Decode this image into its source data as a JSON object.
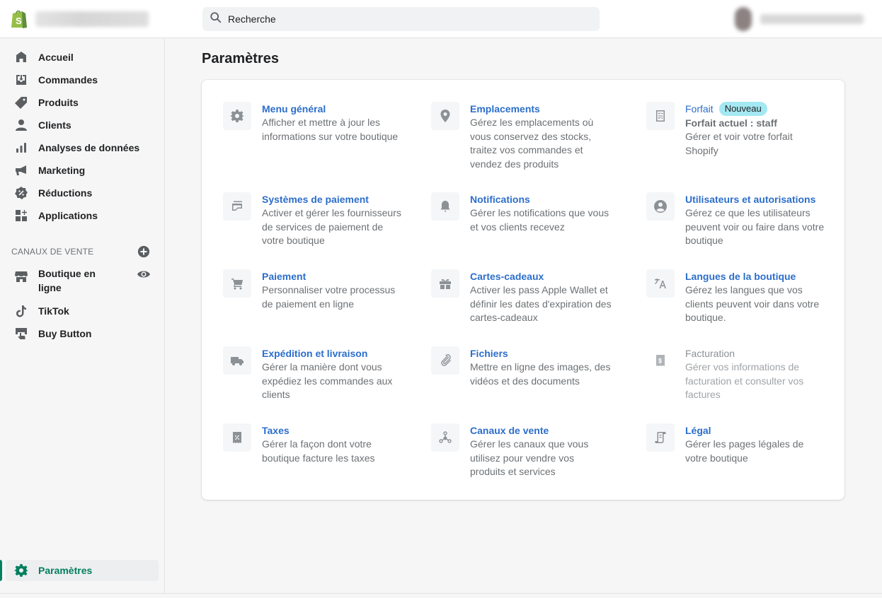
{
  "topbar": {
    "search_placeholder": "Recherche"
  },
  "sidebar": {
    "items": [
      {
        "label": "Accueil",
        "icon": "home-icon"
      },
      {
        "label": "Commandes",
        "icon": "orders-icon"
      },
      {
        "label": "Produits",
        "icon": "tag-icon"
      },
      {
        "label": "Clients",
        "icon": "person-icon"
      },
      {
        "label": "Analyses de données",
        "icon": "analytics-icon"
      },
      {
        "label": "Marketing",
        "icon": "megaphone-icon"
      },
      {
        "label": "Réductions",
        "icon": "discount-icon"
      },
      {
        "label": "Applications",
        "icon": "apps-icon"
      }
    ],
    "channels_title": "CANAUX DE VENTE",
    "channels": [
      {
        "label": "Boutique en ligne",
        "icon": "store-icon"
      },
      {
        "label": "TikTok",
        "icon": "tiktok-icon"
      },
      {
        "label": "Buy Button",
        "icon": "buy-button-icon"
      }
    ],
    "settings_label": "Paramètres"
  },
  "main": {
    "title": "Paramètres",
    "settings": [
      {
        "title": "Menu général",
        "description": "Afficher et mettre à jour les informations sur votre boutique",
        "icon": "gear-icon"
      },
      {
        "title": "Emplacements",
        "description": "Gérez les emplacements où vous conservez des stocks, traitez vos commandes et vendez des produits",
        "icon": "location-pin-icon"
      },
      {
        "title": "Forfait",
        "badge": "Nouveau",
        "subtitle": "Forfait actuel : staff",
        "description": "Gérer et voir votre forfait Shopify",
        "icon": "plan-icon"
      },
      {
        "title": "Systèmes de paiement",
        "description": "Activer et gérer les fournisseurs de services de paiement de votre boutique",
        "icon": "payment-card-icon"
      },
      {
        "title": "Notifications",
        "description": "Gérer les notifications que vous et vos clients recevez",
        "icon": "bell-icon"
      },
      {
        "title": "Utilisateurs et autorisations",
        "description": "Gérez ce que les utilisateurs peuvent voir ou faire dans votre boutique",
        "icon": "user-circle-icon"
      },
      {
        "title": "Paiement",
        "description": "Personnaliser votre processus de paiement en ligne",
        "icon": "cart-icon"
      },
      {
        "title": "Cartes-cadeaux",
        "description": "Activer les pass Apple Wallet et définir les dates d'expiration des cartes-cadeaux",
        "icon": "gift-icon"
      },
      {
        "title": "Langues de la boutique",
        "description": "Gérez les langues que vos clients peuvent voir dans votre boutique.",
        "icon": "translate-icon"
      },
      {
        "title": "Expédition et livraison",
        "description": "Gérer la manière dont vous expédiez les commandes aux clients",
        "icon": "truck-icon"
      },
      {
        "title": "Fichiers",
        "description": "Mettre en ligne des images, des vidéos et des documents",
        "icon": "paperclip-icon"
      },
      {
        "title": "Facturation",
        "description": "Gérer vos informations de facturation et consulter vos factures",
        "icon": "billing-icon",
        "disabled": true
      },
      {
        "title": "Taxes",
        "description": "Gérer la façon dont votre boutique facture les taxes",
        "icon": "tax-receipt-icon"
      },
      {
        "title": "Canaux de vente",
        "description": "Gérer les canaux que vous utilisez pour vendre vos produits et services",
        "icon": "channels-icon"
      },
      {
        "title": "Légal",
        "description": "Gérer les pages légales de votre boutique",
        "icon": "legal-scroll-icon"
      }
    ]
  },
  "colors": {
    "accent_link": "#2c6ecb",
    "active_green": "#008060",
    "badge_bg": "#a4e8f2",
    "shopify_green": "#95bf47"
  }
}
